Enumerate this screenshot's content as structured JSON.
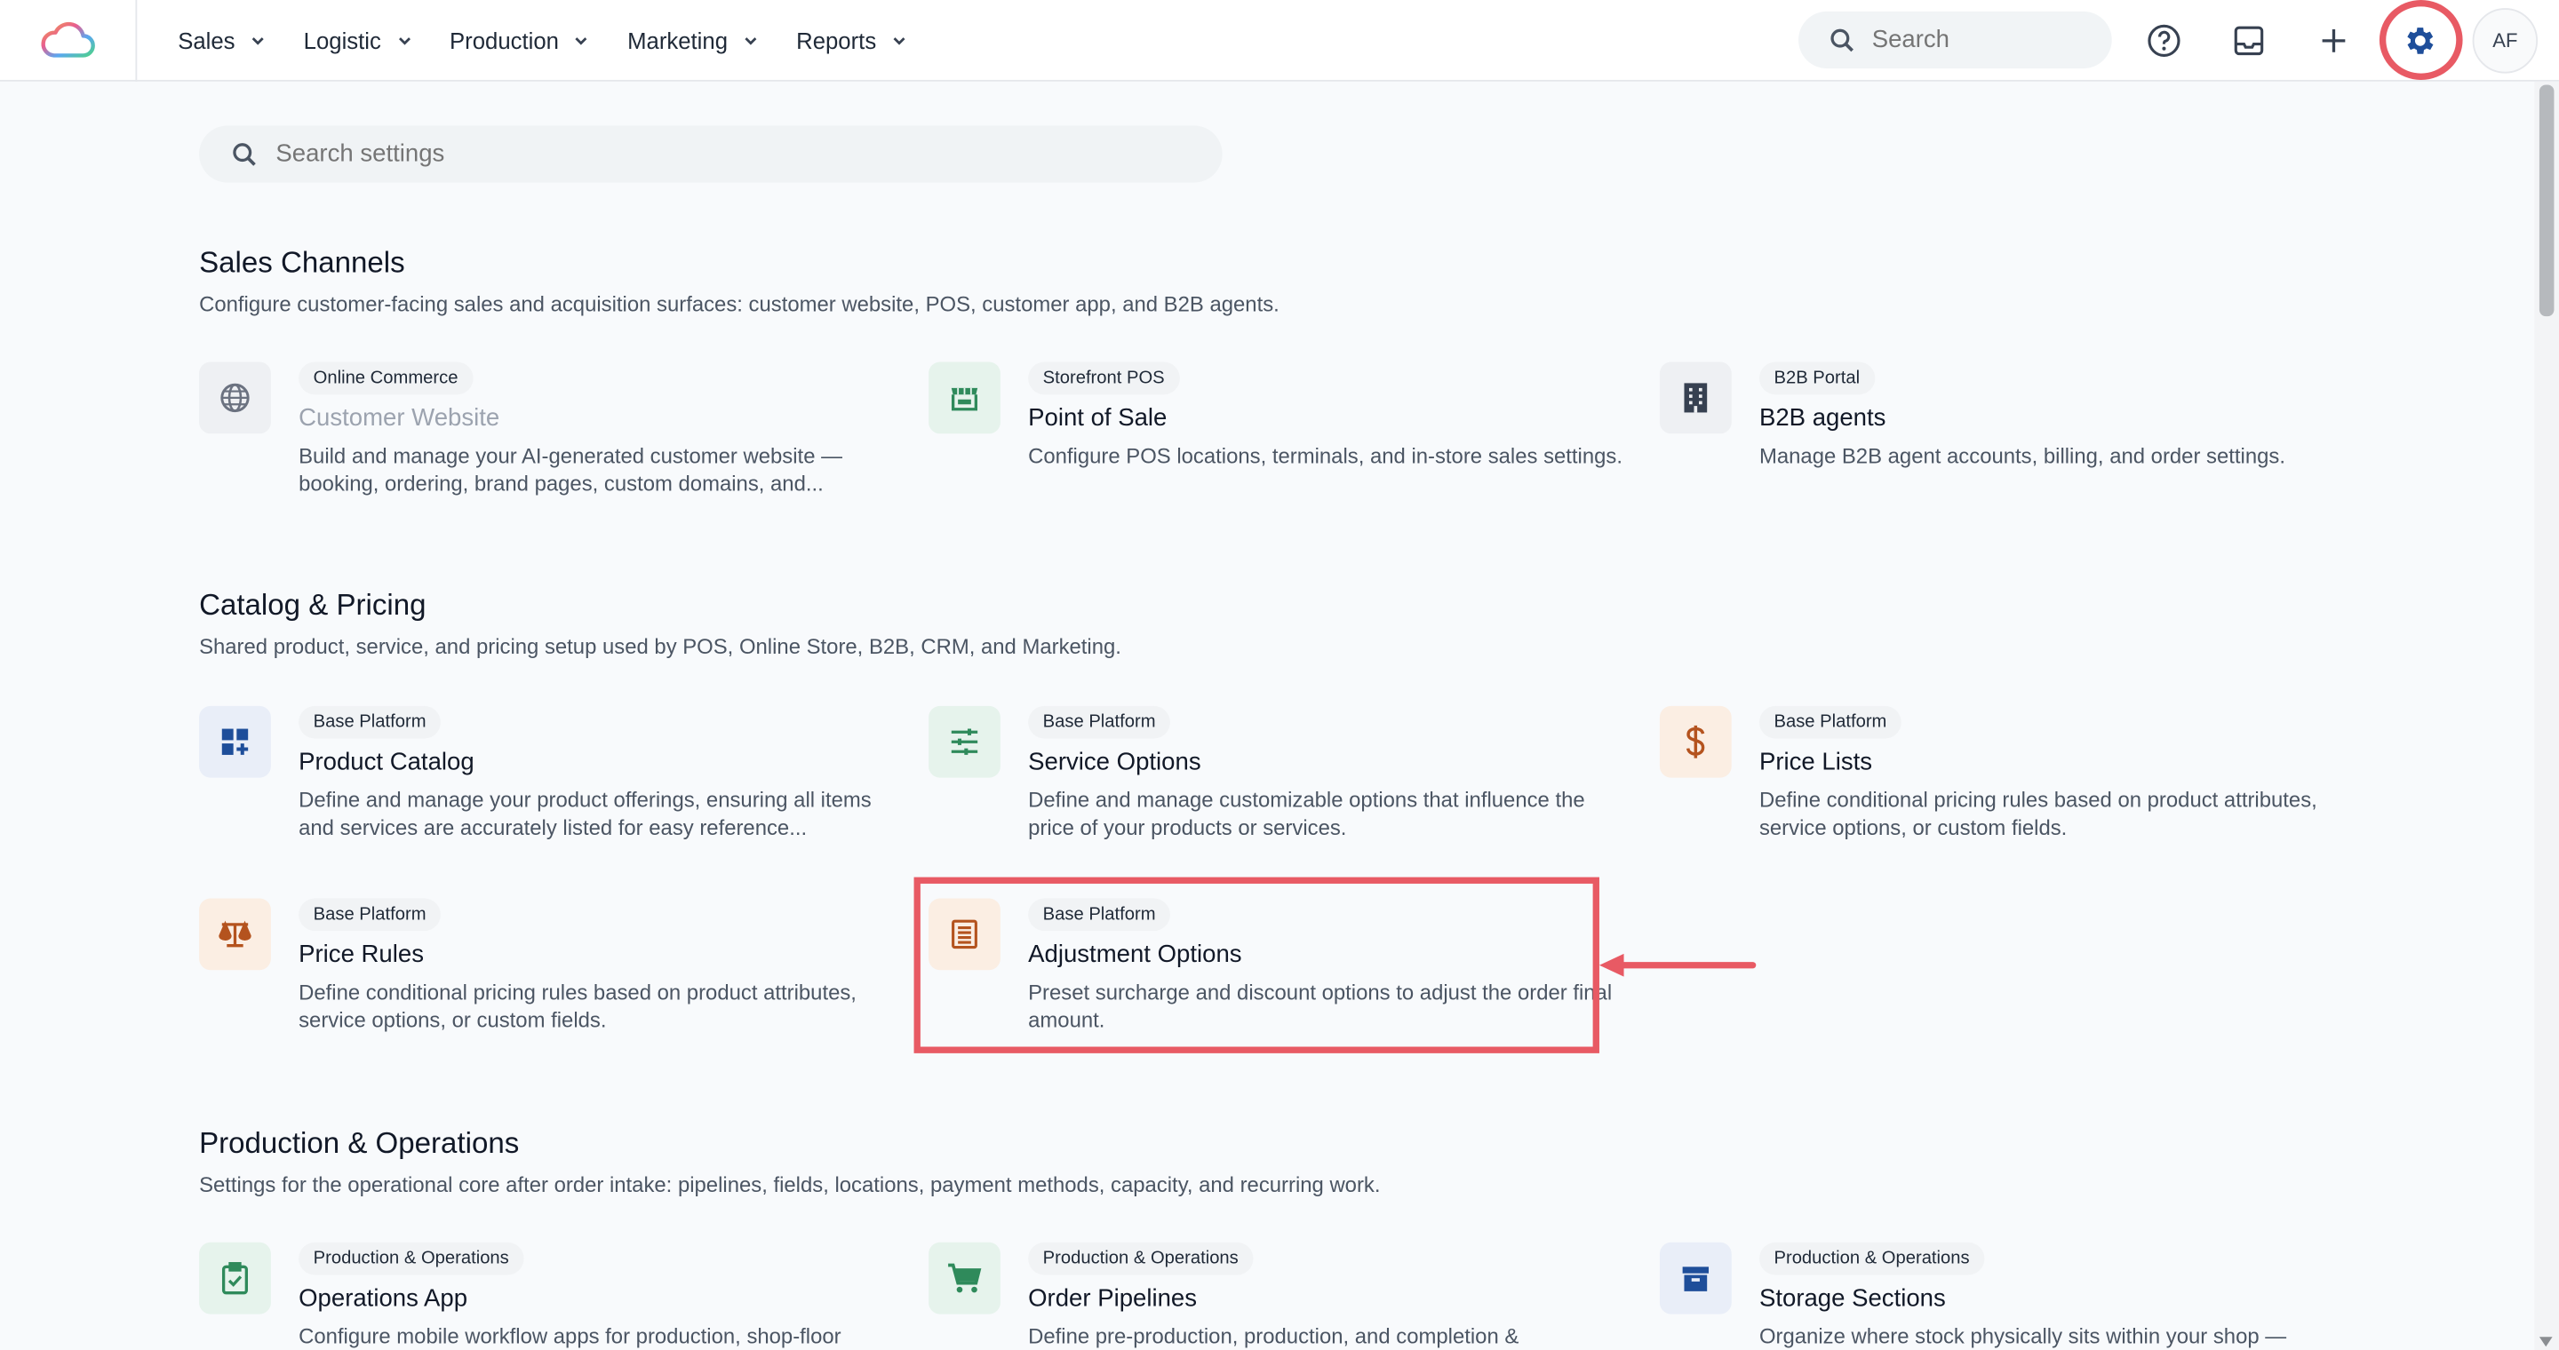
{
  "nav": {
    "items": [
      {
        "label": "Sales"
      },
      {
        "label": "Logistic"
      },
      {
        "label": "Production"
      },
      {
        "label": "Marketing"
      },
      {
        "label": "Reports"
      }
    ],
    "search_placeholder": "Search",
    "avatar_initials": "AF",
    "icons": [
      "cloud-logo-icon",
      "search-icon",
      "help-icon",
      "inbox-icon",
      "plus-icon",
      "gear-icon"
    ]
  },
  "settings_search": {
    "placeholder": "Search settings"
  },
  "sections": [
    {
      "title": "Sales Channels",
      "description": "Configure customer-facing sales and acquisition surfaces: customer website, POS, customer app, and B2B agents.",
      "cards": [
        {
          "badge": "Online Commerce",
          "title": "Customer Website",
          "desc": "Build and manage your AI-generated customer website — booking, ordering, brand pages, custom domains, and...",
          "icon": "globe-icon"
        },
        {
          "badge": "Storefront POS",
          "title": "Point of Sale",
          "desc": "Configure POS locations, terminals, and in-store sales settings.",
          "icon": "store-icon"
        },
        {
          "badge": "B2B Portal",
          "title": "B2B agents",
          "desc": "Manage B2B agent accounts, billing, and order settings.",
          "icon": "building-icon"
        }
      ]
    },
    {
      "title": "Catalog & Pricing",
      "description": "Shared product, service, and pricing setup used by POS, Online Store, B2B, CRM, and Marketing.",
      "cards": [
        {
          "badge": "Base Platform",
          "title": "Product Catalog",
          "desc": "Define and manage your product offerings, ensuring all items and services are accurately listed for easy reference...",
          "icon": "grid-plus-icon"
        },
        {
          "badge": "Base Platform",
          "title": "Service Options",
          "desc": "Define and manage customizable options that influence the price of your products or services.",
          "icon": "sliders-icon"
        },
        {
          "badge": "Base Platform",
          "title": "Price Lists",
          "desc": "Define conditional pricing rules based on product attributes, service options, or custom fields.",
          "icon": "dollar-icon"
        },
        {
          "badge": "Base Platform",
          "title": "Price Rules",
          "desc": "Define conditional pricing rules based on product attributes, service options, or custom fields.",
          "icon": "scale-icon"
        },
        {
          "badge": "Base Platform",
          "title": "Adjustment Options",
          "desc": "Preset surcharge and discount options to adjust the order final amount.",
          "icon": "list-icon"
        }
      ]
    },
    {
      "title": "Production & Operations",
      "description": "Settings for the operational core after order intake: pipelines, fields, locations, payment methods, capacity, and recurring work.",
      "cards": [
        {
          "badge": "Production & Operations",
          "title": "Operations App",
          "desc": "Configure mobile workflow apps for production, shop-floor",
          "icon": "clipboard-check-icon"
        },
        {
          "badge": "Production & Operations",
          "title": "Order Pipelines",
          "desc": "Define pre-production, production, and completion &",
          "icon": "cart-icon"
        },
        {
          "badge": "Production & Operations",
          "title": "Storage Sections",
          "desc": "Organize where stock physically sits within your shop —",
          "icon": "archive-icon"
        }
      ]
    }
  ],
  "colors": {
    "accent_blue": "#1e4e9a",
    "highlight_red": "#e85a64",
    "tile_gray": "#eef0f3",
    "tile_green": "#e6f3ec",
    "tile_blue": "#e9eef8",
    "tile_orange": "#fbeee3"
  }
}
